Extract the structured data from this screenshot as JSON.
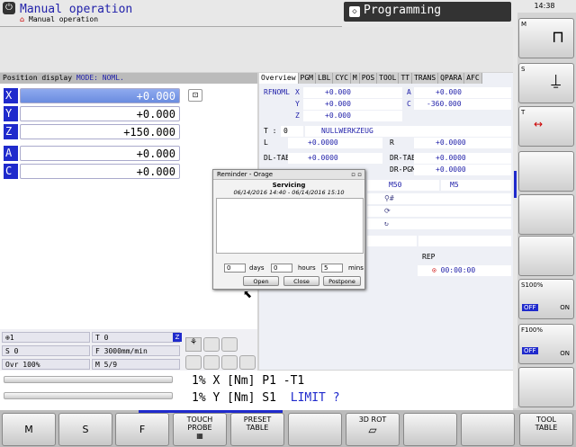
{
  "header": {
    "title": "Manual operation",
    "subtitle": "Manual operation",
    "mode_tab": "Programming",
    "clock": "14:38"
  },
  "position": {
    "bar_label": "Position display",
    "mode_label": "MODE: NOML.",
    "axes": [
      {
        "name": "X",
        "value": "+0.000"
      },
      {
        "name": "Y",
        "value": "+0.000"
      },
      {
        "name": "Z",
        "value": "+150.000"
      },
      {
        "name": "A",
        "value": "+0.000"
      },
      {
        "name": "C",
        "value": "+0.000"
      }
    ]
  },
  "tabs": [
    "Overview",
    "PGM",
    "LBL",
    "CYC",
    "M",
    "POS",
    "TOOL",
    "TT",
    "TRANS",
    "QPARA",
    "AFC"
  ],
  "overview": {
    "rfnoml": "RFNOML",
    "x": "X",
    "y": "Y",
    "z": "Z",
    "xv": "+0.000",
    "yv": "+0.000",
    "zv": "+0.000",
    "a": "A",
    "av": "+0.000",
    "c": "C",
    "cv": "-360.000",
    "t": "T :",
    "t0": "0",
    "tool": "NULLWERKZEUG",
    "l": "L",
    "lv": "+0.0000",
    "r": "R",
    "rv": "+0.0000",
    "dltab": "DL-TAB",
    "dltabv": "+0.0000",
    "drtab": "DR-TAB",
    "drtabv": "+0.0000",
    "drpgm": "DR-PGM",
    "drpgmv": "+0.0000",
    "m50": "M50",
    "m5": "M5",
    "rep": "REP",
    "time": "00:00:00"
  },
  "status": {
    "t1": "1",
    "t": "T 0",
    "s": "S 0",
    "f": "F 3000mm/min",
    "ovr": "Ovr 100%",
    "m": "M 5/9"
  },
  "dialog": {
    "title": "Reminder - Orage",
    "heading": "Servicing",
    "range": "06/14/2016 14:40 - 06/14/2016 15:10",
    "days_val": "0",
    "days": "days",
    "hours_val": "0",
    "hours": "hours",
    "mins_val": "5",
    "mins": "mins",
    "open": "Open",
    "close": "Close",
    "postpone": "Postpone"
  },
  "bottom": {
    "l1": "1% X [Nm]  P1  -T1",
    "l2a": "1% Y [Nm]  S1",
    "l2b": "LIMIT ?"
  },
  "softkeys": [
    {
      "label": "M"
    },
    {
      "label": "S"
    },
    {
      "label": "F"
    },
    {
      "label": "TOUCH\nPROBE"
    },
    {
      "label": "PRESET\nTABLE"
    },
    {
      "label": ""
    },
    {
      "label": "3D ROT"
    },
    {
      "label": ""
    },
    {
      "label": ""
    },
    {
      "label": "TOOL\nTABLE"
    }
  ],
  "vsoftkeys": {
    "m": "M",
    "s": "S",
    "t": "T",
    "s100": "S100%",
    "f100": "F100%",
    "off": "OFF",
    "on": "ON"
  },
  "colors": {
    "accent": "#1f2acc",
    "title": "#2222aa"
  }
}
